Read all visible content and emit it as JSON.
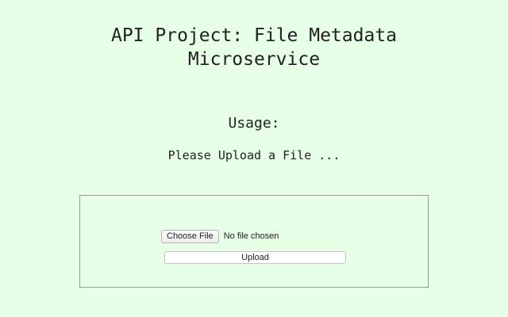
{
  "header": {
    "title_line1": "API Project: File Metadata",
    "title_line2": "Microservice"
  },
  "usage": {
    "heading": "Usage:",
    "instruction": "Please Upload a File ..."
  },
  "upload_form": {
    "choose_file_label": "Choose File",
    "file_status": "No file chosen",
    "upload_label": "Upload"
  },
  "colors": {
    "background": "#e6ffe6",
    "panel_border": "#9a9a9a"
  }
}
